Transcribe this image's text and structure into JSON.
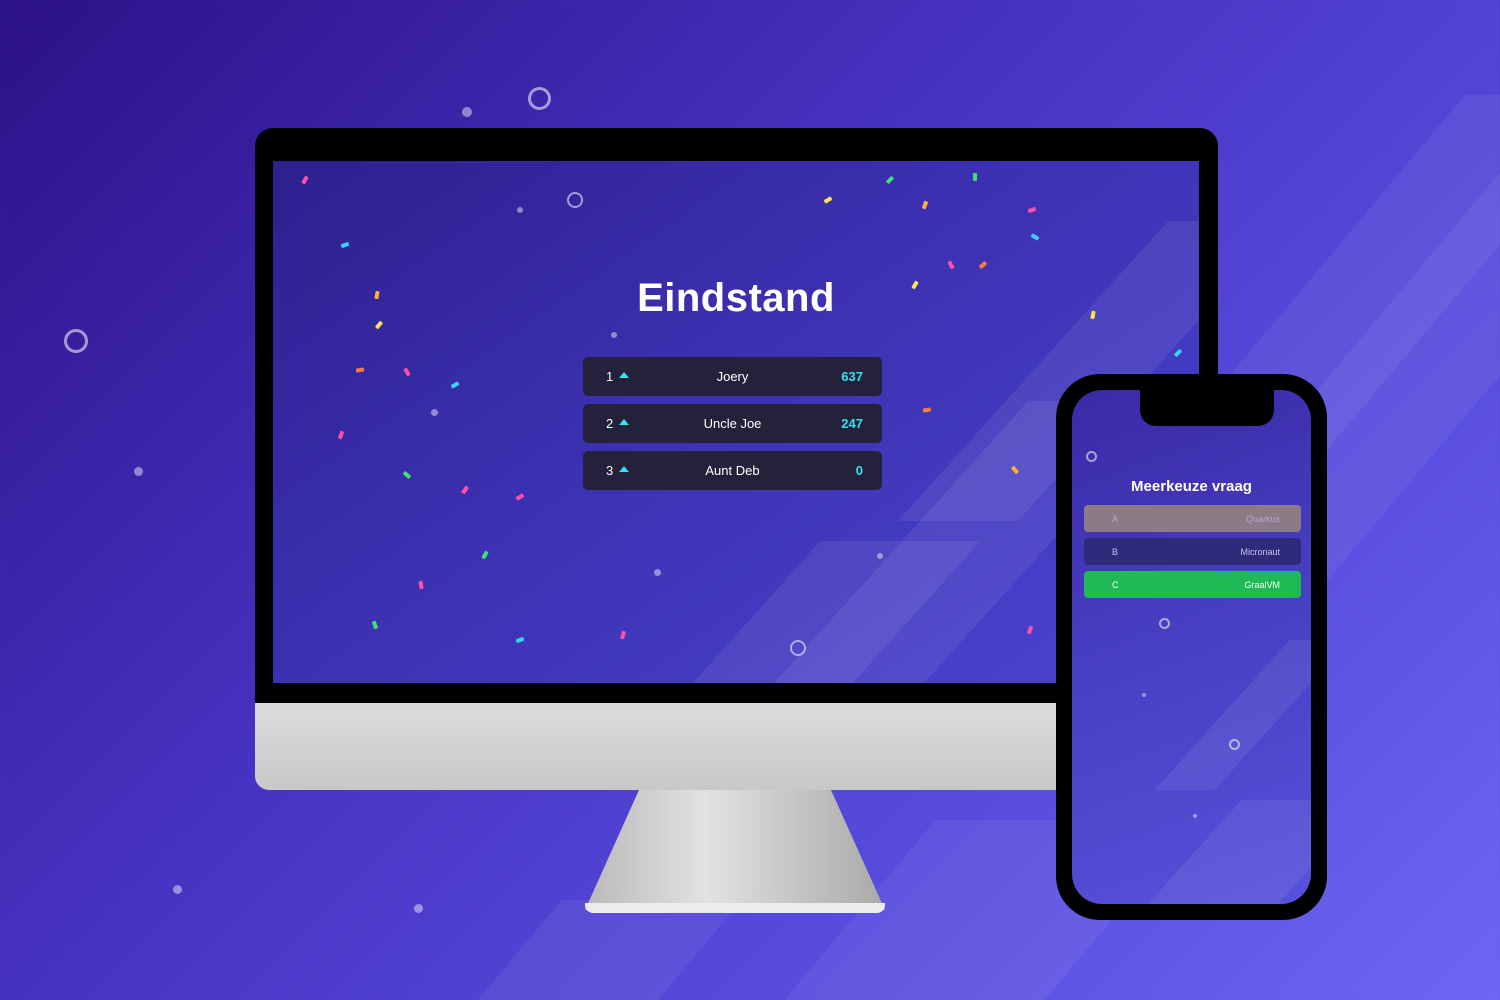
{
  "leaderboard": {
    "title": "Eindstand",
    "rows": [
      {
        "rank": "1",
        "name": "Joery",
        "score": "637"
      },
      {
        "rank": "2",
        "name": "Uncle Joe",
        "score": "247"
      },
      {
        "rank": "3",
        "name": "Aunt Deb",
        "score": "0"
      }
    ]
  },
  "phone": {
    "title": "Meerkeuze vraag",
    "choices": [
      {
        "key": "A",
        "label": "Quarkus",
        "state": "dimmed"
      },
      {
        "key": "B",
        "label": "Micronaut",
        "state": "default"
      },
      {
        "key": "C",
        "label": "GraalVM",
        "state": "correct"
      }
    ]
  },
  "colors": {
    "background_start": "#2c1187",
    "background_end": "#6e66f2",
    "row_background": "#23223a",
    "accent_cyan": "#35e2f0",
    "choice_dimmed": "#8c7a86",
    "choice_default": "#2f2a7a",
    "choice_correct": "#1fb955"
  },
  "icons": {
    "rank_change": "caret-up-icon"
  }
}
